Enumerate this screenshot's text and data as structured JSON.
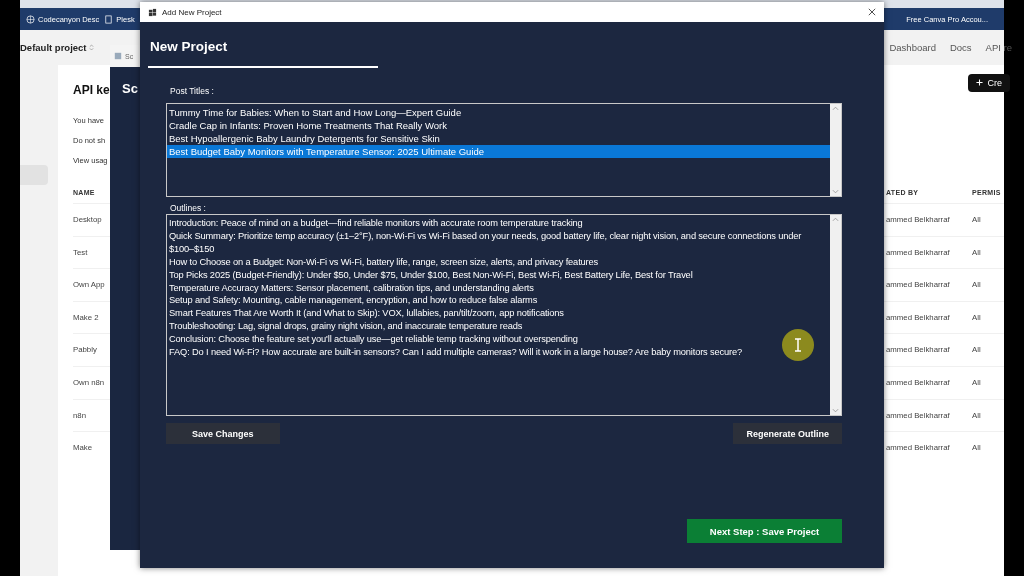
{
  "browser": {
    "bookmarks": [
      {
        "label": "Codecanyon Desc"
      },
      {
        "label": "Plesk"
      },
      {
        "label": "Free Canva Pro Accou..."
      }
    ],
    "project_selector": "Default project",
    "nav": [
      "Dashboard",
      "Docs",
      "API re"
    ],
    "create_button": "Cre",
    "card": {
      "title": "API ke",
      "lines": [
        "You have",
        "Do not sh",
        "View usag"
      ],
      "columns": [
        "NAME",
        "ATED BY",
        "PERMIS"
      ],
      "rows": [
        {
          "name": "Desktop",
          "created_by": "ammed Belkharraf",
          "permissions": "All"
        },
        {
          "name": "Test",
          "created_by": "ammed Belkharraf",
          "permissions": "All"
        },
        {
          "name": "Own App",
          "created_by": "ammed Belkharraf",
          "permissions": "All"
        },
        {
          "name": "Make 2",
          "created_by": "ammed Belkharraf",
          "permissions": "All"
        },
        {
          "name": "Pabbly",
          "created_by": "ammed Belkharraf",
          "permissions": "All"
        },
        {
          "name": "Own n8n",
          "created_by": "ammed Belkharraf",
          "permissions": "All"
        },
        {
          "name": "n8n",
          "created_by": "ammed Belkharraf",
          "permissions": "All"
        },
        {
          "name": "Make",
          "created_by": "ammed Belkharraf",
          "permissions": "All"
        }
      ]
    }
  },
  "back_window": {
    "title": "Sc",
    "heading": "Sc"
  },
  "dialog": {
    "title": "Add New Project",
    "heading": "New Project",
    "post_titles_label": "Post Titles :",
    "post_titles": [
      {
        "text": "Tummy Time for Babies: When to Start and How Long—Expert Guide",
        "selected": false
      },
      {
        "text": "Cradle Cap in Infants: Proven Home Treatments That Really Work",
        "selected": false
      },
      {
        "text": "Best Hypoallergenic Baby Laundry Detergents for Sensitive Skin",
        "selected": false
      },
      {
        "text": "Best Budget Baby Monitors with Temperature Sensor: 2025 Ultimate Guide",
        "selected": true
      }
    ],
    "outlines_label": "Outlines :",
    "outlines": [
      "Introduction: Peace of mind on a budget—find reliable monitors with accurate room temperature tracking",
      "Quick Summary: Prioritize temp accuracy (±1–2°F), non-Wi-Fi vs Wi-Fi based on your needs, good battery life, clear night vision, and secure connections under $100–$150",
      "How to Choose on a Budget: Non-Wi-Fi vs Wi-Fi, battery life, range, screen size, alerts, and privacy features",
      "Top Picks 2025 (Budget-Friendly): Under $50, Under $75, Under $100, Best Non-Wi-Fi, Best Wi-Fi, Best Battery Life, Best for Travel",
      "Temperature Accuracy Matters: Sensor placement, calibration tips, and understanding alerts",
      "Setup and Safety: Mounting, cable management, encryption, and how to reduce false alarms",
      "Smart Features That Are Worth It (and What to Skip): VOX, lullabies, pan/tilt/zoom, app notifications",
      "Troubleshooting: Lag, signal drops, grainy night vision, and inaccurate temperature reads",
      "Conclusion: Choose the feature set you'll actually use—get reliable temp tracking without overspending",
      "FAQ: Do I need Wi-Fi? How accurate are built-in sensors? Can I add multiple cameras? Will it work in a large house? Are baby monitors secure?"
    ],
    "save_button": "Save Changes",
    "regenerate_button": "Regenerate Outline",
    "next_button": "Next Step : Save Project"
  }
}
